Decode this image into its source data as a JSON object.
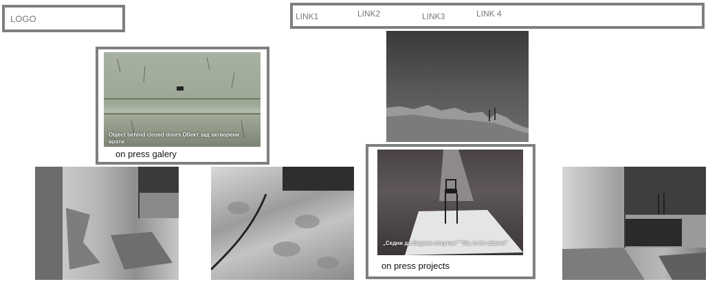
{
  "header": {
    "logo": "LOGO",
    "nav": [
      "LINK1",
      "LINK2",
      "LINK3",
      "LINK 4"
    ]
  },
  "cards": {
    "gallery": {
      "overlay": "Object behind closed doors Обект зад затворени врати",
      "caption": "on press galery"
    },
    "projects": {
      "overlay": "„Седни да бидеме отсутни\" \"Sit, to be absent\"",
      "caption": "on press projects"
    }
  }
}
